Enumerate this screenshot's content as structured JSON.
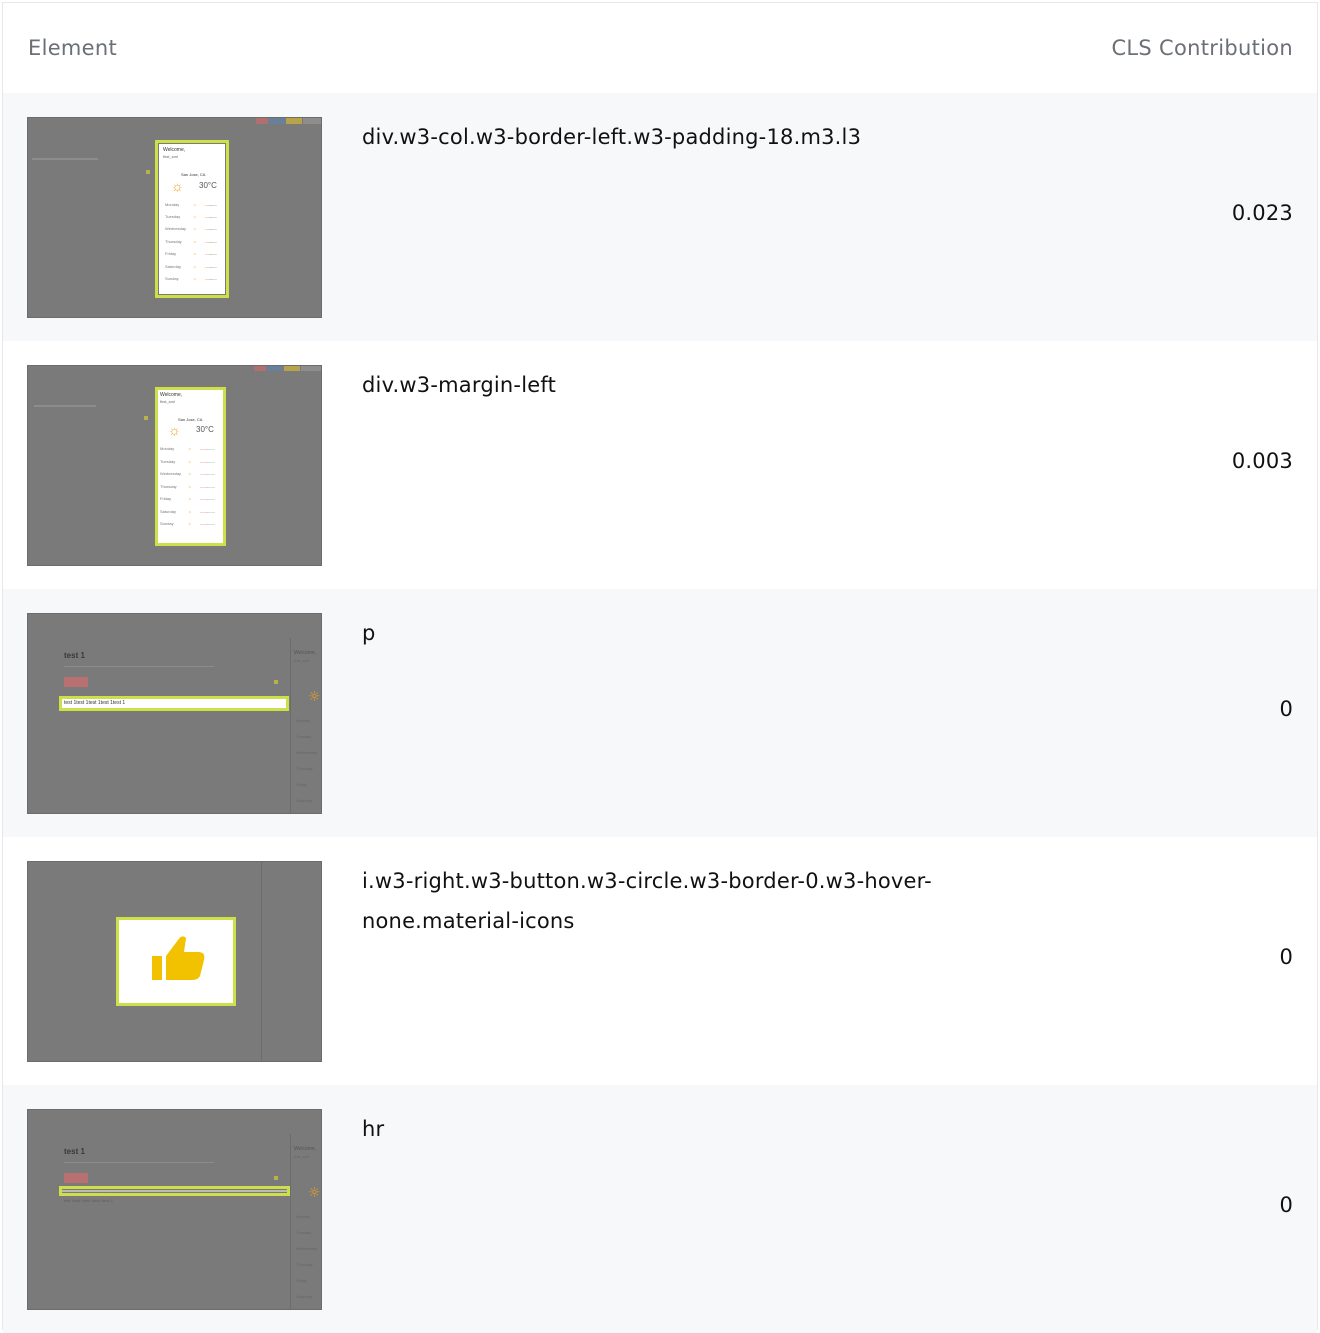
{
  "header": {
    "element_label": "Element",
    "cls_label": "CLS Contribution"
  },
  "rows": [
    {
      "element": "div.w3-col.w3-border-left.w3-padding-18.m3.l3",
      "cls": "0.023"
    },
    {
      "element": "div.w3-margin-left",
      "cls": "0.003"
    },
    {
      "element": "p",
      "cls": "0"
    },
    {
      "element": "i.w3-right.w3-button.w3-circle.w3-border-0.w3-hover-none.material-icons",
      "cls": "0"
    },
    {
      "element": "hr",
      "cls": "0"
    }
  ],
  "thumbs": {
    "weather": {
      "welcome": "Welcome,",
      "user": "first_sml",
      "city": "San Jose, CA",
      "temp": "30°C",
      "days": [
        "Monday",
        "Tuesday",
        "Wednesday",
        "Thursday",
        "Friday",
        "Saturday",
        "Sunday"
      ]
    },
    "post": {
      "title": "test 1",
      "body": "test 1test 1test 1test 1test 1",
      "side_welcome": "Welcome,",
      "side_user": "first_sml",
      "side_days": [
        "Monday",
        "Tuesday",
        "Wednesday",
        "Thursday",
        "Friday",
        "Saturday"
      ]
    }
  },
  "colors": {
    "highlight": "#cde04a",
    "overlay": "#7a7a7a",
    "alt_row": "#f7f8fa"
  }
}
